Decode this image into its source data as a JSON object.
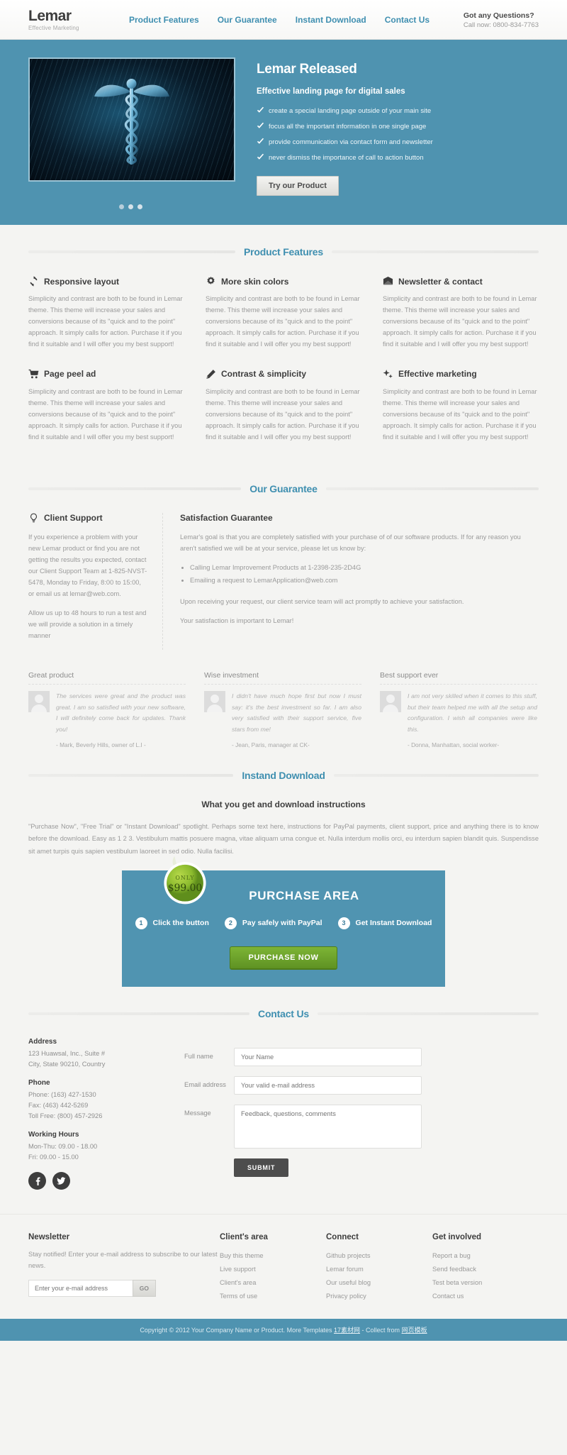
{
  "header": {
    "brand_name": "Lemar",
    "brand_tagline": "Effective Marketing",
    "nav": [
      {
        "label": "Product Features"
      },
      {
        "label": "Our Guarantee"
      },
      {
        "label": "Instant Download"
      },
      {
        "label": "Contact Us"
      }
    ],
    "questions_title": "Got any Questions?",
    "call_now": "Call now: 0800-834-7763"
  },
  "hero": {
    "title": "Lemar Released",
    "subtitle": "Effective landing page for digital sales",
    "bullets": [
      "create a special landing page outside of your main site",
      "focus all the important information in one single page",
      "provide communication via contact form and newsletter",
      "never dismiss the importance of call to action button"
    ],
    "cta_label": "Try our Product",
    "slide_count": 3,
    "active_slide": 1
  },
  "features": {
    "section_title": "Product Features",
    "body_text": "Simplicity and contrast are both to be found in Lemar theme. This theme will increase your sales and conversions because of its \"quick and to the point\" approach. It simply calls for action. Purchase it if you find it suitable and I will offer you my best support!",
    "items": [
      {
        "title": "Responsive layout",
        "icon": "refresh-icon"
      },
      {
        "title": "More skin colors",
        "icon": "gear-icon"
      },
      {
        "title": "Newsletter & contact",
        "icon": "envelope-icon"
      },
      {
        "title": "Page peel ad",
        "icon": "cart-icon"
      },
      {
        "title": "Contrast & simplicity",
        "icon": "pencil-icon"
      },
      {
        "title": "Effective marketing",
        "icon": "sparkle-icon"
      }
    ]
  },
  "guarantee": {
    "section_title": "Our Guarantee",
    "left_title": "Client Support",
    "left_icon": "lightbulb-icon",
    "left_p1": "If you experience a problem with your new Lemar product or find you are not getting the results you expected, contact our Client Support Team at 1-825-NVST-5478, Monday to Friday, 8:00 to 15:00, or email us at lemar@web.com.",
    "left_p2": "Allow us up to 48 hours to run a test and we will provide a solution in a timely manner",
    "right_title": "Satisfaction Guarantee",
    "right_p1": "Lemar's goal is that you are completely satisfied with your purchase of of our software products. If for any reason you aren't satisfied we will be at your service, please let us know by:",
    "right_bullets": [
      "Calling Lemar Improvement Products at 1-2398-235-2D4G",
      "Emailing a request to LemarApplication@web.com"
    ],
    "right_p2": "Upon receiving your request, our client service team will act promptly to achieve your satisfaction.",
    "right_p3": "Your satisfaction is important to Lemar!"
  },
  "testimonials": [
    {
      "title": "Great product",
      "quote": "The services were great and the product was great. I am so satisfied with your new software, I will definitely come back for updates. Thank you!",
      "author": "- Mark, Beverly Hills, owner of L.I -"
    },
    {
      "title": "Wise investment",
      "quote": "I didn't have much hope first but now I must say: it's the best investment so far. I am also very satisfied with their support service, five stars from me!",
      "author": "- Jean, Paris, manager at CK-"
    },
    {
      "title": "Best support ever",
      "quote": "I am not very skilled when it comes to this stuff, but their team helped me with all the setup and configuration. I wish all companies were like this.",
      "author": "- Donna, Manhattan, social worker-"
    }
  ],
  "download": {
    "section_title": "Instand Download",
    "heading": "What you get and download instructions",
    "body": "\"Purchase Now\", \"Free Trial\" or \"Instant Download\" spotlight. Perhaps some text here, instructions for PayPal payments, client support, price and anything there is to know before the download. Easy as 1 2 3. Vestibulum mattis posuere magna, vitae aliquam urna congue et. Nulla interdum mollis orci, eu interdum sapien blandit quis. Suspendisse sit amet turpis quis sapien vestibulum laoreet in sed odio. Nulla facilisi.",
    "badge_only": "ONLY",
    "badge_price": "$99.00",
    "purchase_title": "PURCHASE AREA",
    "steps": [
      {
        "num": "1",
        "label": "Click the button"
      },
      {
        "num": "2",
        "label": "Pay safely with PayPal"
      },
      {
        "num": "3",
        "label": "Get Instant Download"
      }
    ],
    "buy_label": "PURCHASE NOW"
  },
  "contact": {
    "section_title": "Contact Us",
    "address_label": "Address",
    "address_lines": "123 Huawsal, Inc., Suite #\nCity, State 90210, Country",
    "phone_label": "Phone",
    "phone_lines": "Phone: (163) 427-1530\nFax: (463) 442-5269\nToll Free: (800) 457-2926",
    "hours_label": "Working Hours",
    "hours_lines": "Mon-Thu: 09.00 - 18.00\nFri: 09.00 - 15.00",
    "socials": [
      {
        "name": "facebook-icon",
        "glyph": "f"
      },
      {
        "name": "twitter-icon",
        "glyph": "t"
      }
    ],
    "form": {
      "fullname_label": "Full name",
      "fullname_placeholder": "Your Name",
      "email_label": "Email address",
      "email_placeholder": "Your valid e-mail address",
      "message_label": "Message",
      "message_placeholder": "Feedback, questions, comments",
      "submit_label": "SUBMIT"
    }
  },
  "footer": {
    "newsletter": {
      "title": "Newsletter",
      "text": "Stay notified! Enter your e-mail address to subscribe to our latest news.",
      "placeholder": "Enter your e-mail address",
      "go_label": "GO"
    },
    "columns": [
      {
        "title": "Client's area",
        "links": [
          "Buy this theme",
          "Live support",
          "Client's area",
          "Terms of use"
        ]
      },
      {
        "title": "Connect",
        "links": [
          "Github projects",
          "Lemar forum",
          "Our useful blog",
          "Privacy policy"
        ]
      },
      {
        "title": "Get involved",
        "links": [
          "Report a bug",
          "Send feedback",
          "Test beta version",
          "Contact us"
        ]
      }
    ],
    "copyright_pre": "Copyright © 2012 Your Company Name or Product. More Templates ",
    "copyright_link1": "17素材网",
    "copyright_mid": " - Collect from ",
    "copyright_link2": "网页模板"
  },
  "colors": {
    "accent": "#3f8fb0",
    "hero_bg": "#4f93b0",
    "purchase_bg": "#5094b1",
    "buy_green": "#6ba32b"
  }
}
